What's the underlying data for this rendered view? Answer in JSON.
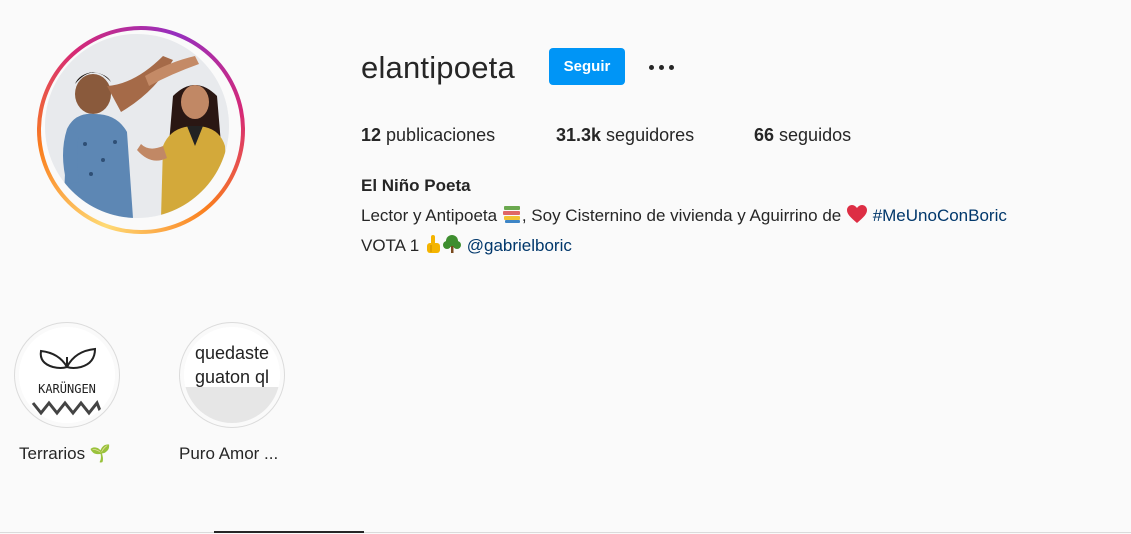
{
  "profile": {
    "username": "elantipoeta",
    "follow_label": "Seguir",
    "more_icon": "more-options-icon"
  },
  "stats": {
    "posts_count": "12",
    "posts_label": " publicaciones",
    "followers_count": "31.3k",
    "followers_label": " seguidores",
    "following_count": "66",
    "following_label": " seguidos"
  },
  "bio": {
    "full_name": "El Niño Poeta",
    "line1_a": "Lector y Antipoeta ",
    "line1_b": ", Soy Cisternino de vivienda y Aguirrino de ",
    "hashtag": "#MeUnoConBoric",
    "line2_a": "VOTA 1 ",
    "mention": "@gabrielboric",
    "emoji_icons": [
      "books-icon",
      "heart-icon",
      "pointing-hand-icon",
      "tree-icon"
    ]
  },
  "highlights": [
    {
      "label": "Terrarios 🌱",
      "cover_text": "KARÜNGEN"
    },
    {
      "label": "Puro Amor ...",
      "cover_line1": "quedaste",
      "cover_line2": "guaton ql"
    }
  ],
  "colors": {
    "accent_blue": "#0095f6",
    "link_blue": "#00376b",
    "text": "#262626",
    "background": "#fafafa"
  }
}
